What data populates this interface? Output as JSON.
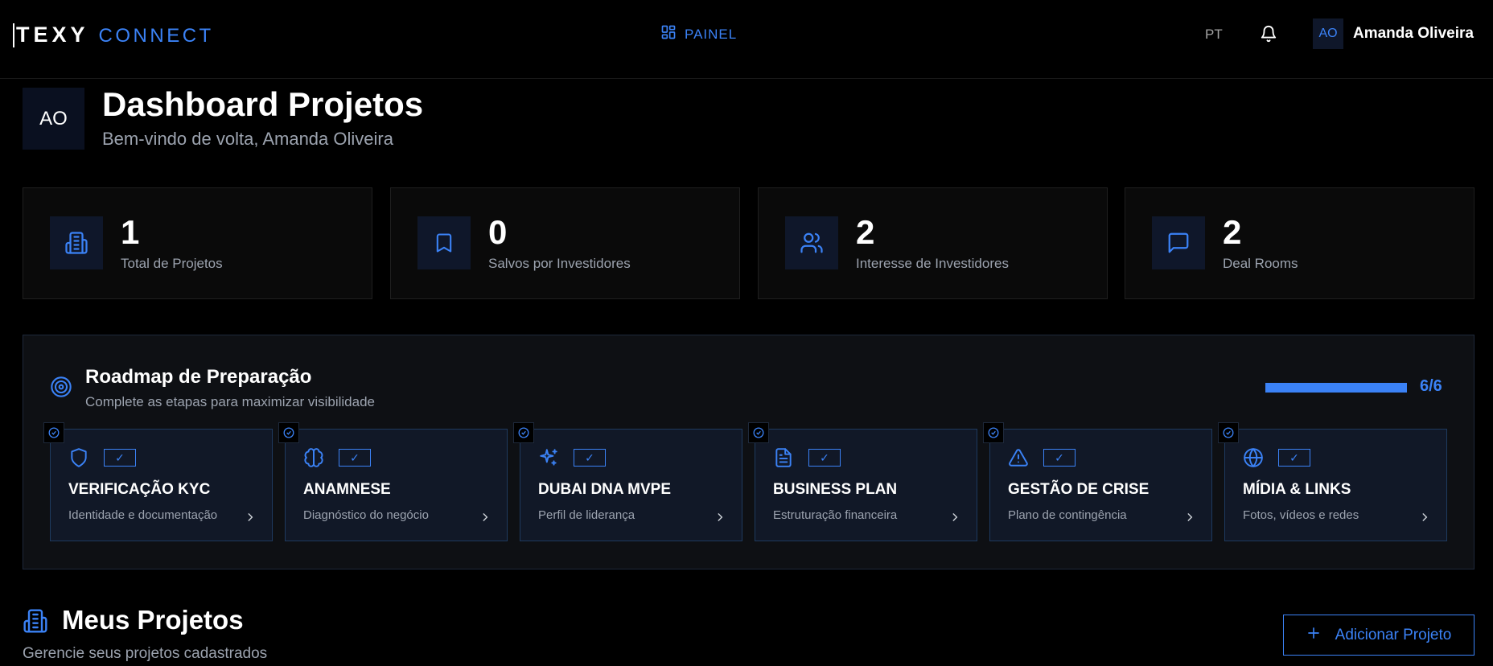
{
  "header": {
    "brand_main": "TEXY",
    "brand_sub": "CONNECT",
    "nav_painel": "PAINEL",
    "language": "PT",
    "user_initials": "AO",
    "user_name": "Amanda Oliveira"
  },
  "page": {
    "avatar_initials": "AO",
    "title": "Dashboard Projetos",
    "subtitle": "Bem-vindo de volta, Amanda Oliveira"
  },
  "stats": [
    {
      "value": "1",
      "label": "Total de Projetos",
      "icon": "building-icon"
    },
    {
      "value": "0",
      "label": "Salvos por Investidores",
      "icon": "bookmark-icon"
    },
    {
      "value": "2",
      "label": "Interesse de Investidores",
      "icon": "users-icon"
    },
    {
      "value": "2",
      "label": "Deal Rooms",
      "icon": "message-icon"
    }
  ],
  "roadmap": {
    "title": "Roadmap de Preparação",
    "subtitle": "Complete as etapas para maximizar visibilidade",
    "progress_text": "6/6",
    "progress_fraction": 1.0,
    "steps": [
      {
        "title": "VERIFICAÇÃO KYC",
        "subtitle": "Identidade e documentação",
        "icon": "shield-icon",
        "check": "✓"
      },
      {
        "title": "ANAMNESE",
        "subtitle": "Diagnóstico do negócio",
        "icon": "brain-icon",
        "check": "✓"
      },
      {
        "title": "DUBAI DNA MVPE",
        "subtitle": "Perfil de liderança",
        "icon": "sparkles-icon",
        "check": "✓"
      },
      {
        "title": "BUSINESS PLAN",
        "subtitle": "Estruturação financeira",
        "icon": "file-icon",
        "check": "✓"
      },
      {
        "title": "GESTÃO DE CRISE",
        "subtitle": "Plano de contingência",
        "icon": "warning-icon",
        "check": "✓"
      },
      {
        "title": "MÍDIA & LINKS",
        "subtitle": "Fotos, vídeos e redes",
        "icon": "globe-icon",
        "check": "✓"
      }
    ]
  },
  "projects": {
    "title": "Meus Projetos",
    "subtitle": "Gerencie seus projetos cadastrados",
    "add_label": "Adicionar Projeto"
  },
  "colors": {
    "accent": "#3b82f6",
    "background": "#000000"
  }
}
